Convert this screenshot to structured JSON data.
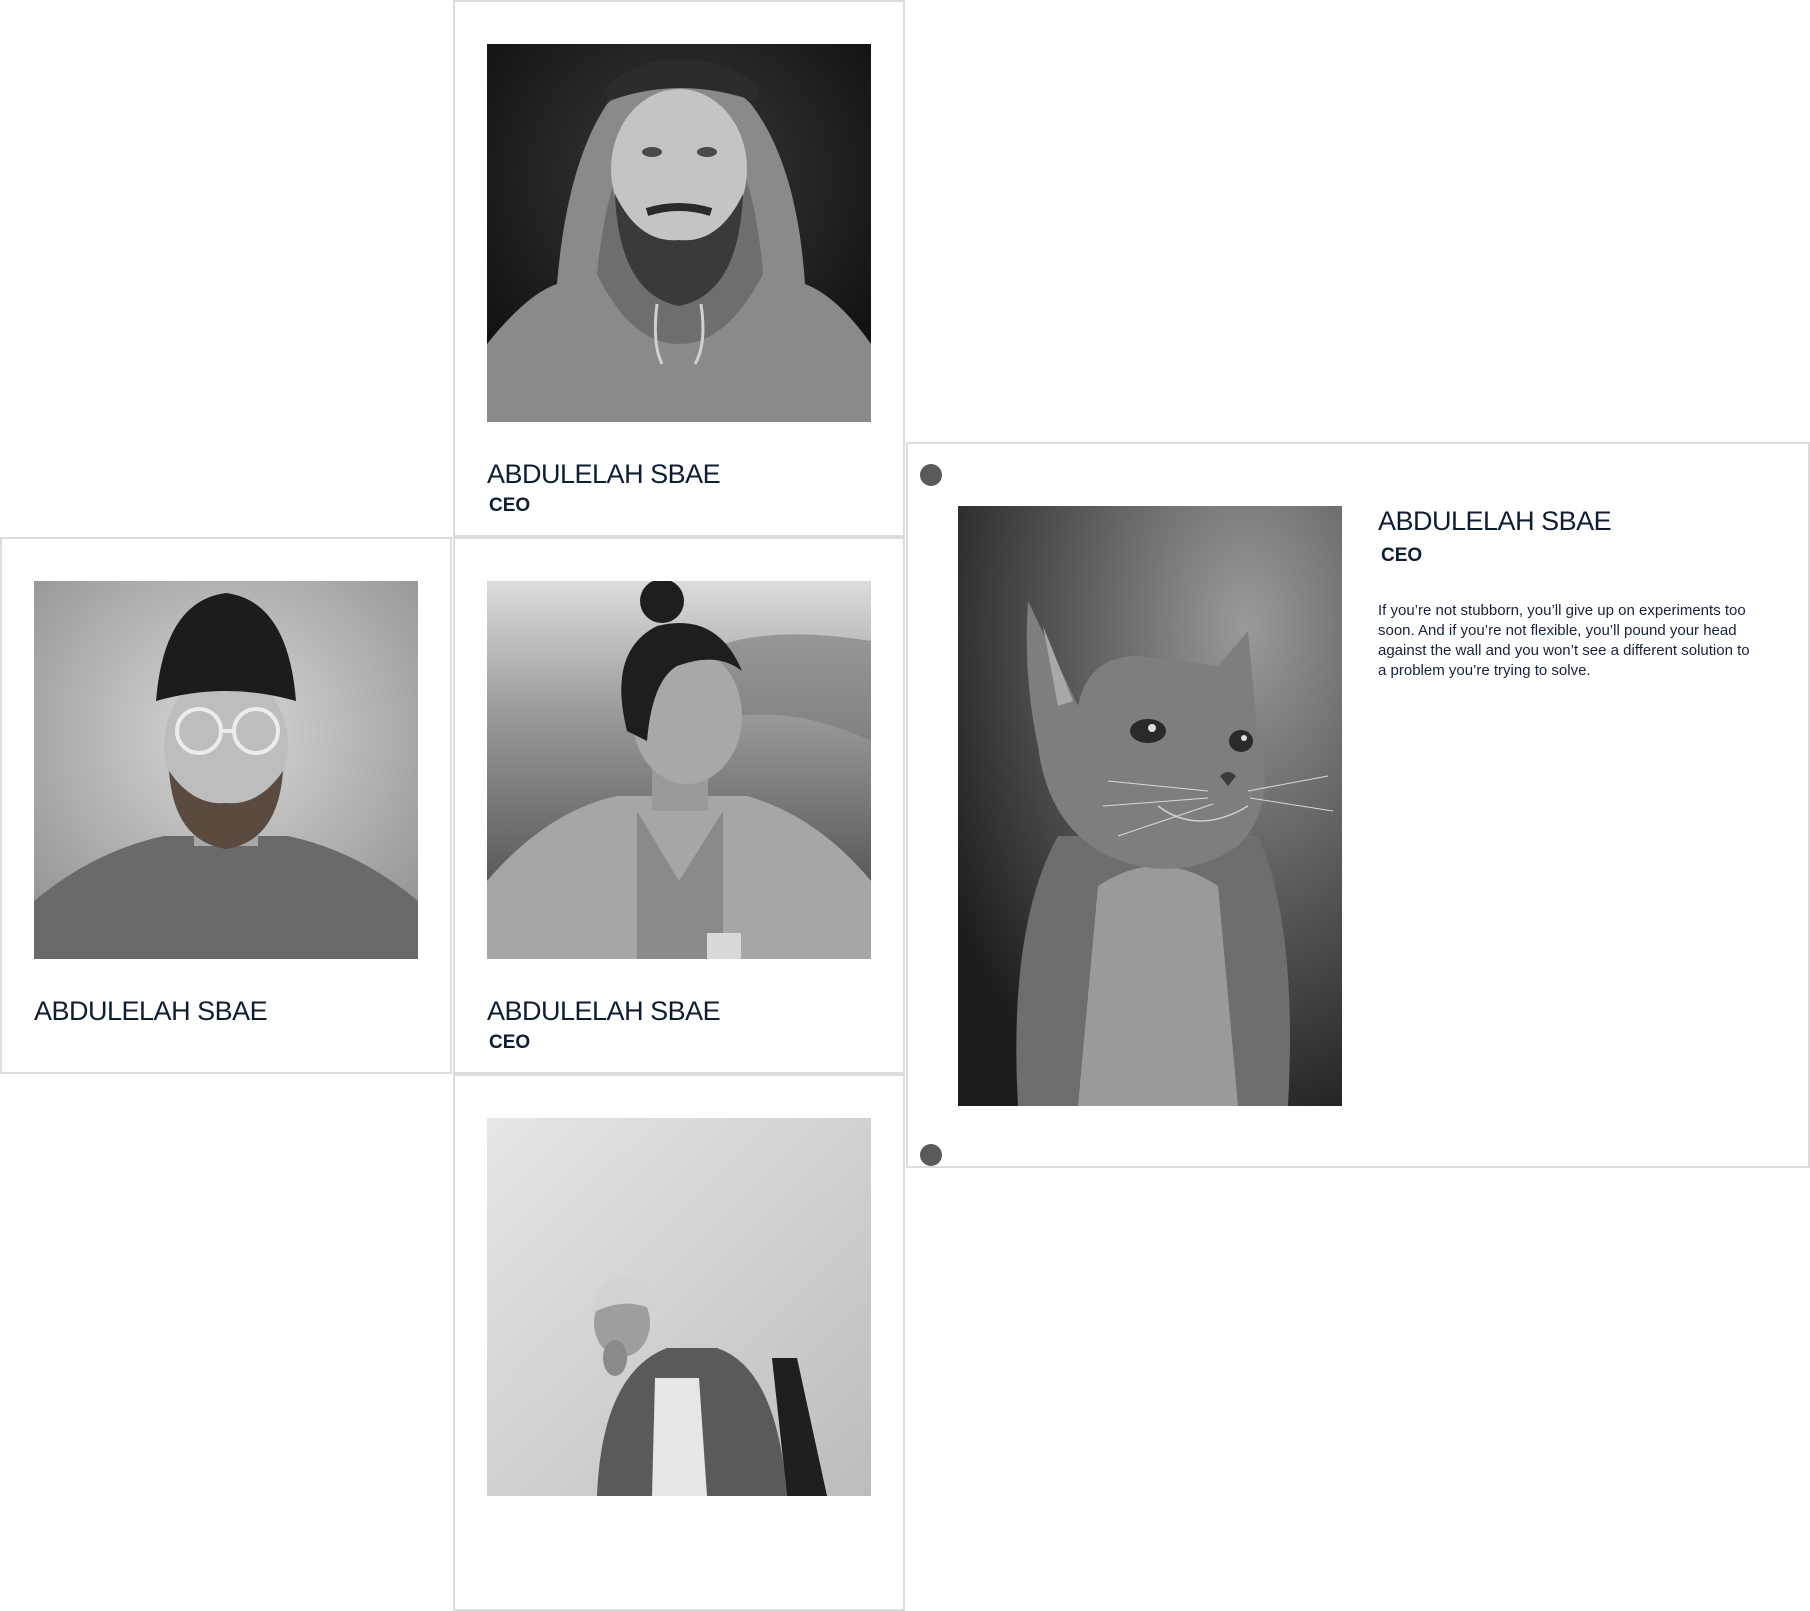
{
  "cards": [
    {
      "name": "ABDULELAH SBAE",
      "role": "CEO",
      "photo": "portrait-bearded-man-hoodie"
    },
    {
      "name": "ABDULELAH SBAE",
      "role": "",
      "photo": "portrait-man-beanie-glasses"
    },
    {
      "name": "ABDULELAH SBAE",
      "role": "CEO",
      "photo": "portrait-young-man-hair-bun"
    },
    {
      "name": "",
      "role": "",
      "photo": "portrait-man-seated-chair"
    }
  ],
  "detail": {
    "name": "ABDULELAH SBAE",
    "role": "CEO",
    "bio": "If you’re not stubborn, you’ll give up on experiments too soon. And if you’re not flexible, you’ll pound your head against the wall and you won’t see a different solution to a problem you’re trying to solve.",
    "photo": "portrait-cat"
  }
}
